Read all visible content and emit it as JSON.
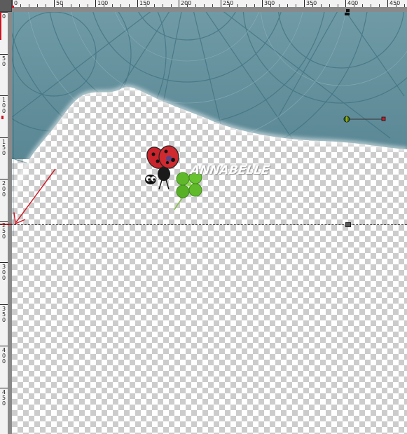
{
  "ruler_top": {
    "labels": [
      "0",
      "50",
      "100",
      "150",
      "200",
      "250",
      "300",
      "350",
      "400",
      "450"
    ]
  },
  "ruler_left": {
    "labels": [
      "0",
      "5 0",
      "1 0 0",
      "1 5 0",
      "2 0 0",
      "2 5 0",
      "3 0 0",
      "3 5 0",
      "4 0 0",
      "4 5 0"
    ]
  },
  "canvas": {
    "watermark_text": "ANNABELLE",
    "fabric_color": "#5f8d9a",
    "arrow_color": "#d0121f",
    "icons": [
      "ladybug-icon",
      "four-leaf-clover-icon",
      "arrow-icon",
      "gradient-handle-icon"
    ]
  }
}
